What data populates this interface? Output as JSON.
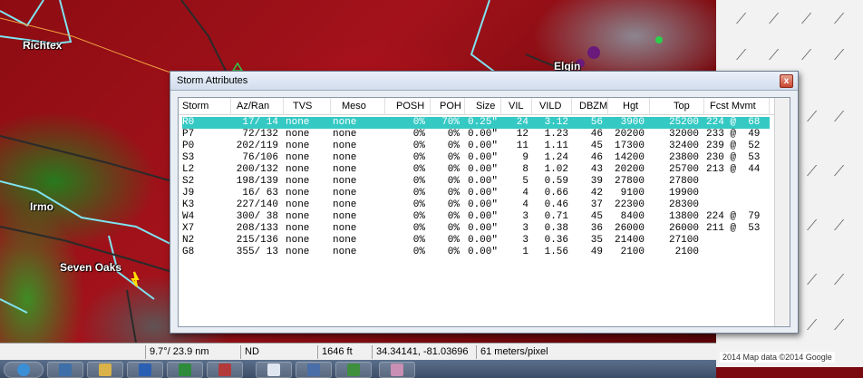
{
  "map": {
    "cities": [
      "Richtex",
      "Elgin",
      "Irmo",
      "Seven Oaks"
    ]
  },
  "statusbar": {
    "azran": "9.7°/ 23.9 nm",
    "value": "ND",
    "height": "1646 ft",
    "latlon": "34.34141, -81.03696",
    "resolution": "61 meters/pixel"
  },
  "gmap": {
    "attribution": "2014  Map data ©2014 Google"
  },
  "window": {
    "title": "Storm Attributes",
    "close_label": "x",
    "columns": [
      "Storm",
      "Az/Ran",
      "TVS",
      "Meso",
      "POSH",
      "POH",
      "Size",
      "VIL",
      "VILD",
      "DBZM",
      "Hgt",
      "Top",
      "Fcst Mvmt"
    ],
    "rows": [
      [
        "R0",
        "17/ 14",
        "none",
        "none",
        "0%",
        "70%",
        "0.25\"",
        "24",
        "3.12",
        "56",
        "3900",
        "25200",
        "224 @  68"
      ],
      [
        "P7",
        "72/132",
        "none",
        "none",
        "0%",
        "0%",
        "0.00\"",
        "12",
        "1.23",
        "46",
        "20200",
        "32000",
        "233 @  49"
      ],
      [
        "P0",
        "202/119",
        "none",
        "none",
        "0%",
        "0%",
        "0.00\"",
        "11",
        "1.11",
        "45",
        "17300",
        "32400",
        "239 @  52"
      ],
      [
        "S3",
        "76/106",
        "none",
        "none",
        "0%",
        "0%",
        "0.00\"",
        "9",
        "1.24",
        "46",
        "14200",
        "23800",
        "230 @  53"
      ],
      [
        "L2",
        "200/132",
        "none",
        "none",
        "0%",
        "0%",
        "0.00\"",
        "8",
        "1.02",
        "43",
        "20200",
        "25700",
        "213 @  44"
      ],
      [
        "S2",
        "198/139",
        "none",
        "none",
        "0%",
        "0%",
        "0.00\"",
        "5",
        "0.59",
        "39",
        "27800",
        "27800",
        ""
      ],
      [
        "J9",
        "16/ 63",
        "none",
        "none",
        "0%",
        "0%",
        "0.00\"",
        "4",
        "0.66",
        "42",
        "9100",
        "19900",
        ""
      ],
      [
        "K3",
        "227/140",
        "none",
        "none",
        "0%",
        "0%",
        "0.00\"",
        "4",
        "0.46",
        "37",
        "22300",
        "28300",
        ""
      ],
      [
        "W4",
        "300/ 38",
        "none",
        "none",
        "0%",
        "0%",
        "0.00\"",
        "3",
        "0.71",
        "45",
        "8400",
        "13800",
        "224 @  79"
      ],
      [
        "X7",
        "208/133",
        "none",
        "none",
        "0%",
        "0%",
        "0.00\"",
        "3",
        "0.38",
        "36",
        "26000",
        "26000",
        "211 @  53"
      ],
      [
        "N2",
        "215/136",
        "none",
        "none",
        "0%",
        "0%",
        "0.00\"",
        "3",
        "0.36",
        "35",
        "21400",
        "27100",
        ""
      ],
      [
        "G8",
        "355/ 13",
        "none",
        "none",
        "0%",
        "0%",
        "0.00\"",
        "1",
        "1.56",
        "49",
        "2100",
        "2100",
        ""
      ]
    ],
    "selected_row": 0
  },
  "colors": {
    "selection": "#35c9c4",
    "radar_red": "#a3121b",
    "radar_green": "#1e8c2a"
  },
  "taskbar": {
    "icons": [
      "start-orb-icon",
      "app-icon",
      "file-explorer-icon",
      "word-icon",
      "excel-icon",
      "media-icon",
      "notepad-icon",
      "disk-icon",
      "dreamweaver-icon",
      "image-viewer-icon"
    ]
  }
}
